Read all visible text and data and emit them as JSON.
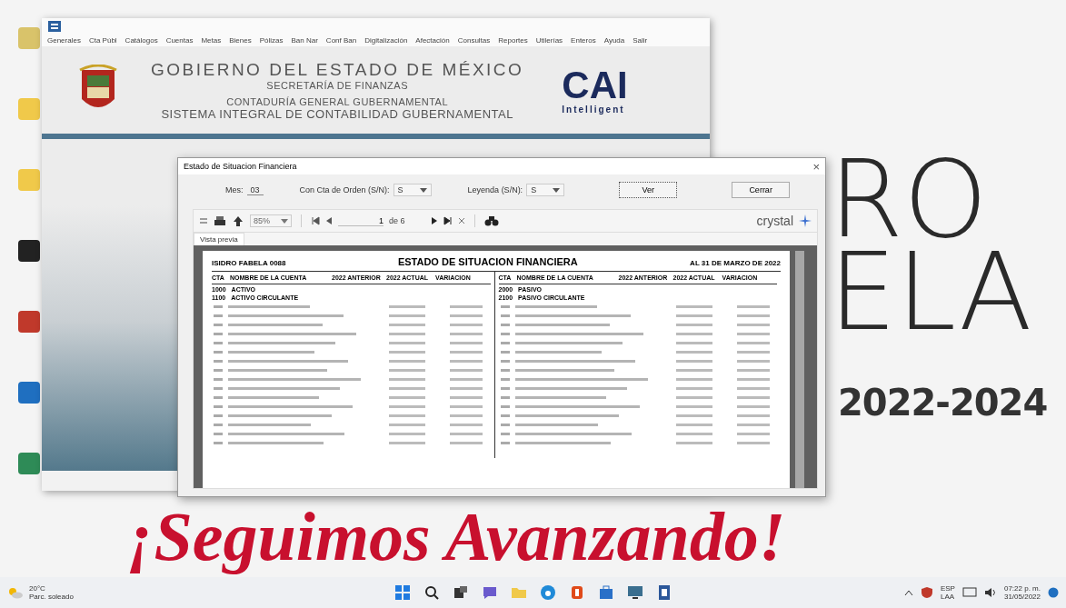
{
  "wallpaper": {
    "line_1": "RO",
    "line_2": "ELA",
    "years": "2022-2024",
    "slogan": "¡Seguimos Avanzando!"
  },
  "main_window": {
    "menu": [
      "Generales",
      "Cta Públ",
      "Catálogos",
      "Cuentas",
      "Metas",
      "Bienes",
      "Pólizas",
      "Ban Nar",
      "Conf Ban",
      "Digitalización",
      "Afectación",
      "Consultas",
      "Reportes",
      "Utilerías",
      "Enteros",
      "Ayuda",
      "Salir"
    ],
    "banner": {
      "title": "GOBIERNO DEL ESTADO DE MÉXICO",
      "subtitle": "SECRETARÍA DE FINANZAS",
      "line_1": "CONTADURÍA GENERAL GUBERNAMENTAL",
      "line_2": "SISTEMA INTEGRAL DE CONTABILIDAD GUBERNAMENTAL",
      "logo_text": "CAI",
      "logo_subtext": "Intelligent"
    }
  },
  "dialog": {
    "title": "Estado de Situacion Financiera",
    "close": "×",
    "fields": [
      {
        "label": "Mes:",
        "value": "03",
        "kind": "text"
      },
      {
        "label": "Con Cta de Orden (S/N):",
        "value": "S",
        "kind": "dropdown"
      },
      {
        "label": "Leyenda (S/N):",
        "value": "S",
        "kind": "dropdown"
      }
    ],
    "buttons": [
      {
        "label": "Ver",
        "focused": true
      },
      {
        "label": "Cerrar",
        "focused": false
      }
    ],
    "viewer": {
      "zoom": "85%",
      "page": "1",
      "page_of": "de 6",
      "brand": "crystal",
      "tabs": [
        {
          "label": "Vista previa",
          "selected": true
        }
      ],
      "report": {
        "title": "ESTADO DE SITUACION FINANCIERA",
        "entity": "ISIDRO FABELA 0088",
        "date": "AL 31 DE MARZO DE 2022",
        "left_columns": [
          "CTA",
          "NOMBRE DE LA CUENTA",
          "2022 ANTERIOR",
          "2022 ACTUAL",
          "VARIACION"
        ],
        "right_columns": [
          "CTA",
          "NOMBRE DE LA CUENTA",
          "2022 ANTERIOR",
          "2022 ACTUAL",
          "VARIACION"
        ],
        "left_sections": [
          {
            "code": "1000",
            "name": "ACTIVO"
          },
          {
            "code": "1100",
            "name": "ACTIVO CIRCULANTE"
          }
        ],
        "right_sections": [
          {
            "code": "2000",
            "name": "PASIVO"
          },
          {
            "code": "2100",
            "name": "PASIVO CIRCULANTE"
          }
        ]
      }
    }
  },
  "taskbar": {
    "weather": {
      "temp": "20°C",
      "text": "Parc. soleado"
    },
    "language": "ESP",
    "language_sub": "LAA",
    "time": "07:22 p. m.",
    "date": "31/05/2022"
  }
}
